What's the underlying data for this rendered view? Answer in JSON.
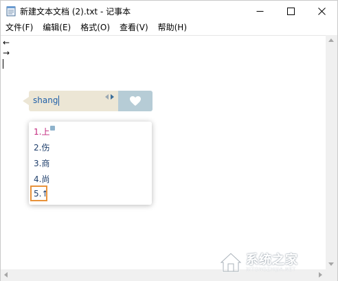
{
  "window": {
    "title": "新建文本文档 (2).txt - 记事本"
  },
  "menubar": {
    "items": [
      {
        "label": "文件(F)"
      },
      {
        "label": "编辑(E)"
      },
      {
        "label": "格式(O)"
      },
      {
        "label": "查看(V)"
      },
      {
        "label": "帮助(H)"
      }
    ]
  },
  "editor": {
    "lines": [
      "←",
      "→"
    ]
  },
  "ime": {
    "composition": "shang",
    "candidates": [
      {
        "label": "1.上"
      },
      {
        "label": "2.伤"
      },
      {
        "label": "3.商"
      },
      {
        "label": "4.尚"
      },
      {
        "label": "5.↑"
      }
    ],
    "highlighted_candidate": 5
  },
  "colors": {
    "ime_bar": "#ece6d5",
    "ime_logo_bg": "#b6ccd6",
    "candidate_text": "#1e3e6b",
    "first_candidate": "#c2257c",
    "highlight_box": "#e8923a"
  },
  "watermark": {
    "text": "系统之家",
    "sub": "XITONGZHIJIA.NET"
  }
}
